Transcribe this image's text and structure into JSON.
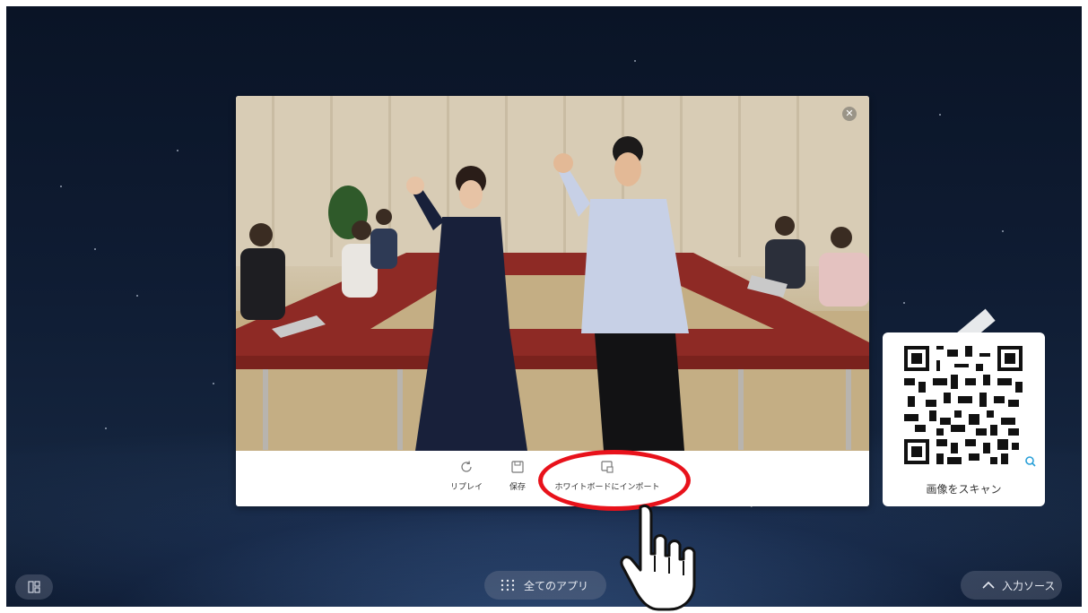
{
  "photo_panel": {
    "close_icon": "close-icon",
    "actions": [
      {
        "label": "リプレイ",
        "icon": "replay-icon"
      },
      {
        "label": "保存",
        "icon": "save-icon"
      },
      {
        "label": "ホワイトボードにインポート",
        "icon": "import-icon"
      }
    ]
  },
  "qr_card": {
    "label": "画像をスキャン",
    "icon": "zoom-icon"
  },
  "bottom_bar": {
    "multi_window_icon": "multi-window-icon",
    "all_apps_label": "全てのアプリ",
    "input_source_label": "入力ソース"
  },
  "annotation": {
    "color": "#e8121b"
  }
}
